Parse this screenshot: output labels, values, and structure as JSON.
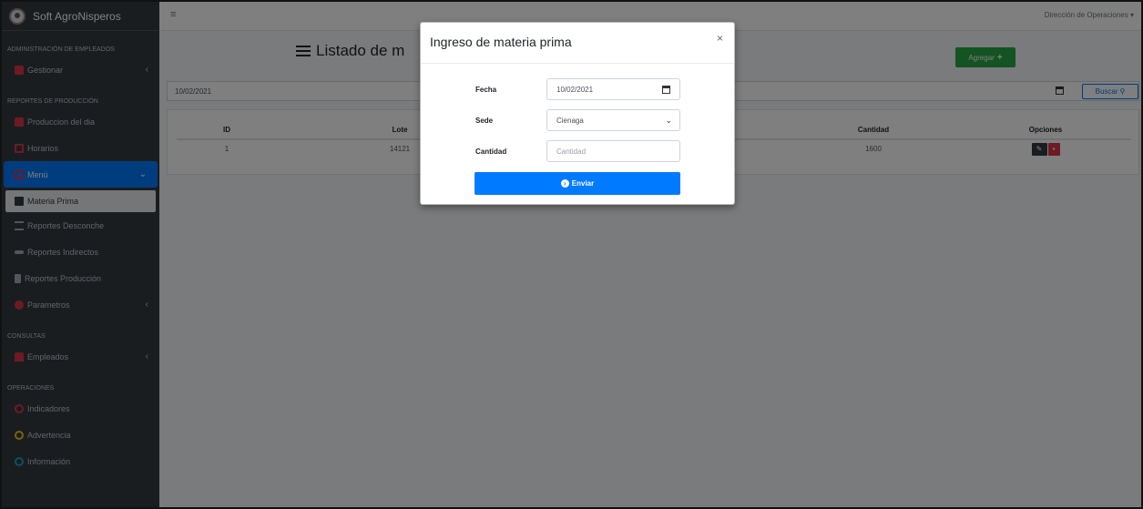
{
  "brand": {
    "name": "Soft AgroNisperos"
  },
  "sidebar": {
    "sections": [
      {
        "header": "ADMINISTRACIÓN DE EMPLEADOS"
      },
      {
        "header": "REPORTES DE PRODUCCIÓN"
      },
      {
        "header": "CONSULTAS"
      },
      {
        "header": "OPERACIONES"
      }
    ],
    "items": {
      "gestionar": "Gestionar",
      "produccion_dia": "Produccion del dia",
      "horarios": "Horarios",
      "menu": "Menú",
      "materia_prima": "Materia Prima",
      "reportes_desconche": "Reportes Desconche",
      "reportes_indirectos": "Reportes Indirectos",
      "reportes_produccion": "Reportes Producción",
      "parametros": "Parametros",
      "empleados": "Empleados",
      "indicadores": "Indicadores",
      "advertencia": "Advertencia",
      "informacion": "Información"
    }
  },
  "topnav": {
    "user_menu": "Dirección de Operaciones ▾"
  },
  "page": {
    "title": "Listado de m",
    "add_button": "Agregar",
    "date_filter": "10/02/2021",
    "search_button": "Buscar"
  },
  "table": {
    "headers": {
      "id": "ID",
      "lote": "Lote",
      "cantidad": "Cantidad",
      "opciones": "Opciones"
    },
    "rows": [
      {
        "id": "1",
        "lote": "14121",
        "cantidad": "1600"
      }
    ]
  },
  "modal": {
    "title": "Ingreso de materia prima",
    "close": "×",
    "fecha_label": "Fecha",
    "fecha_value": "10/02/2021",
    "sede_label": "Sede",
    "sede_value": "Cienaga",
    "cantidad_label": "Cantidad",
    "cantidad_placeholder": "Cantidad",
    "submit": "Enviar"
  },
  "colors": {
    "primary": "#007bff",
    "success": "#28a745",
    "danger": "#dc3545",
    "sidebar": "#343a40"
  }
}
